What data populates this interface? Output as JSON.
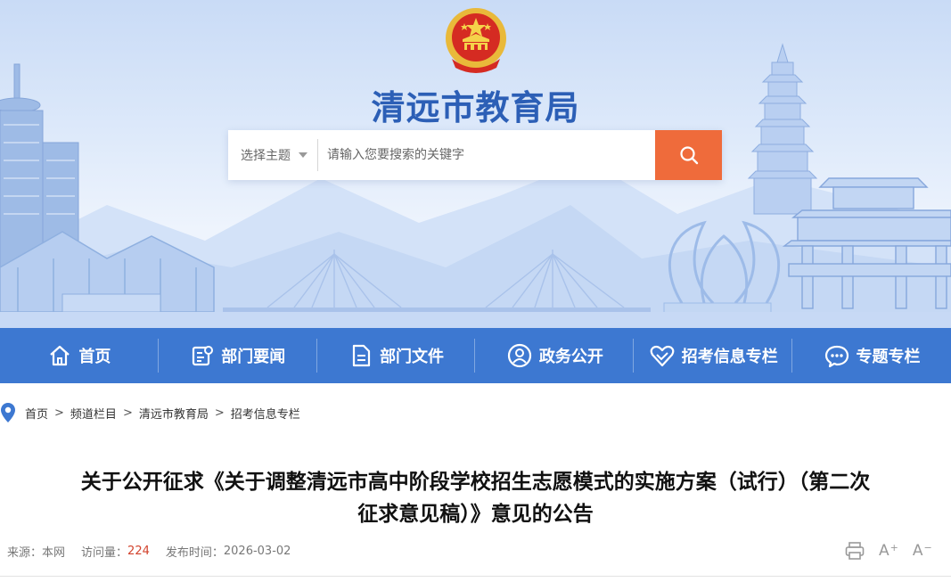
{
  "header": {
    "site_title": "清远市教育局",
    "emblem_icon": "national-emblem-icon"
  },
  "search": {
    "topic_label": "选择主题",
    "placeholder": "请输入您要搜索的关键字",
    "button_icon": "search-icon"
  },
  "nav": {
    "items": [
      {
        "label": "首页",
        "icon": "home-icon"
      },
      {
        "label": "部门要闻",
        "icon": "news-icon"
      },
      {
        "label": "部门文件",
        "icon": "document-icon"
      },
      {
        "label": "政务公开",
        "icon": "user-circle-icon"
      },
      {
        "label": "招考信息专栏",
        "icon": "heart-icon"
      },
      {
        "label": "专题专栏",
        "icon": "chat-icon"
      }
    ]
  },
  "breadcrumb": {
    "items": [
      "首页",
      "频道栏目",
      "清远市教育局",
      "招考信息专栏"
    ],
    "separator": ">"
  },
  "article": {
    "title_line1": "关于公开征求《关于调整清远市高中阶段学校招生志愿模式的实施方案（试行）（第二次",
    "title_line2": "征求意见稿）》意见的公告",
    "source_label": "来源：",
    "source_value": "本网",
    "views_label": "访问量：",
    "views_value": "224",
    "date_label": "发布时间：",
    "date_value": "2026-03-02"
  },
  "tools": {
    "print_icon": "print-icon",
    "font_larger": "A",
    "font_larger_mark": "+",
    "font_smaller": "A",
    "font_smaller_mark": "−"
  },
  "colors": {
    "nav_bg": "#3d78d1",
    "title_blue": "#2c5fb6",
    "search_button": "#ef6b3b",
    "views_red": "#d2422c"
  }
}
